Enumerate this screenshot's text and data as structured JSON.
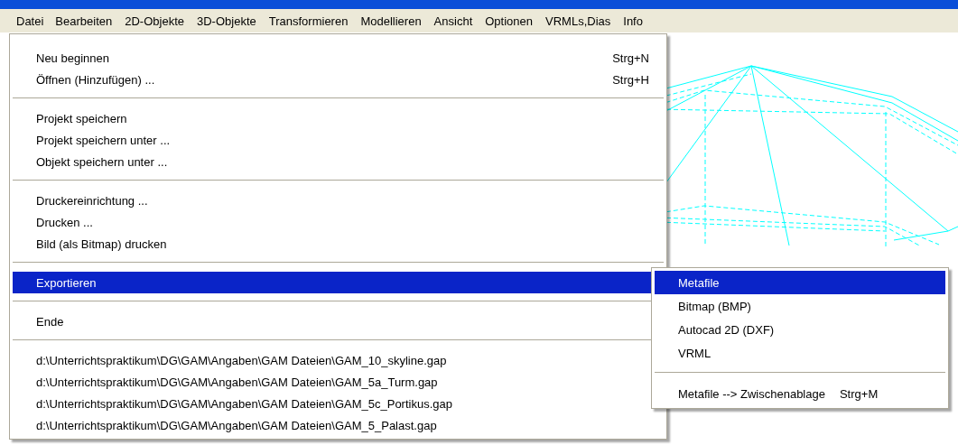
{
  "menubar": [
    {
      "label": "Datei",
      "selected": true
    },
    {
      "label": "Bearbeiten",
      "selected": false
    },
    {
      "label": "2D-Objekte",
      "selected": false
    },
    {
      "label": "3D-Objekte",
      "selected": false
    },
    {
      "label": "Transformieren",
      "selected": false
    },
    {
      "label": "Modellieren",
      "selected": false
    },
    {
      "label": "Ansicht",
      "selected": false
    },
    {
      "label": "Optionen",
      "selected": false
    },
    {
      "label": "VRMLs,Dias",
      "selected": false
    },
    {
      "label": "Info",
      "selected": false
    }
  ],
  "menu": {
    "items": [
      {
        "kind": "item",
        "label": "Neu beginnen",
        "shortcut": "Strg+N",
        "selected": false
      },
      {
        "kind": "item",
        "label": "Öffnen (Hinzufügen) ...",
        "shortcut": "Strg+H",
        "selected": false
      },
      {
        "kind": "separator"
      },
      {
        "kind": "item",
        "label": "Projekt speichern",
        "selected": false
      },
      {
        "kind": "item",
        "label": "Projekt speichern unter ...",
        "selected": false
      },
      {
        "kind": "item",
        "label": "Objekt speichern unter ...",
        "selected": false
      },
      {
        "kind": "separator"
      },
      {
        "kind": "item",
        "label": "Druckereinrichtung ...",
        "selected": false
      },
      {
        "kind": "item",
        "label": "Drucken ...",
        "selected": false
      },
      {
        "kind": "item",
        "label": "Bild (als Bitmap) drucken",
        "selected": false
      },
      {
        "kind": "separator"
      },
      {
        "kind": "submenu",
        "label": "Exportieren",
        "selected": true
      },
      {
        "kind": "separator"
      },
      {
        "kind": "item",
        "label": "Ende",
        "selected": false
      },
      {
        "kind": "separator"
      },
      {
        "kind": "item",
        "label": "d:\\Unterrichtspraktikum\\DG\\GAM\\Angaben\\GAM Dateien\\GAM_10_skyline.gap",
        "selected": false
      },
      {
        "kind": "item",
        "label": "d:\\Unterrichtspraktikum\\DG\\GAM\\Angaben\\GAM Dateien\\GAM_5a_Turm.gap",
        "selected": false
      },
      {
        "kind": "item",
        "label": "d:\\Unterrichtspraktikum\\DG\\GAM\\Angaben\\GAM Dateien\\GAM_5c_Portikus.gap",
        "selected": false
      },
      {
        "kind": "item",
        "label": "d:\\Unterrichtspraktikum\\DG\\GAM\\Angaben\\GAM Dateien\\GAM_5_Palast.gap",
        "selected": false
      }
    ]
  },
  "submenu": {
    "items": [
      {
        "kind": "item",
        "label": "Metafile",
        "selected": true
      },
      {
        "kind": "item",
        "label": "Bitmap (BMP)",
        "selected": false
      },
      {
        "kind": "item",
        "label": "Autocad 2D (DXF)",
        "selected": false
      },
      {
        "kind": "item",
        "label": "VRML",
        "selected": false
      },
      {
        "kind": "separator"
      },
      {
        "kind": "item",
        "label": "Metafile --> Zwischenablage",
        "shortcut": "Strg+M",
        "selected": false
      }
    ]
  }
}
